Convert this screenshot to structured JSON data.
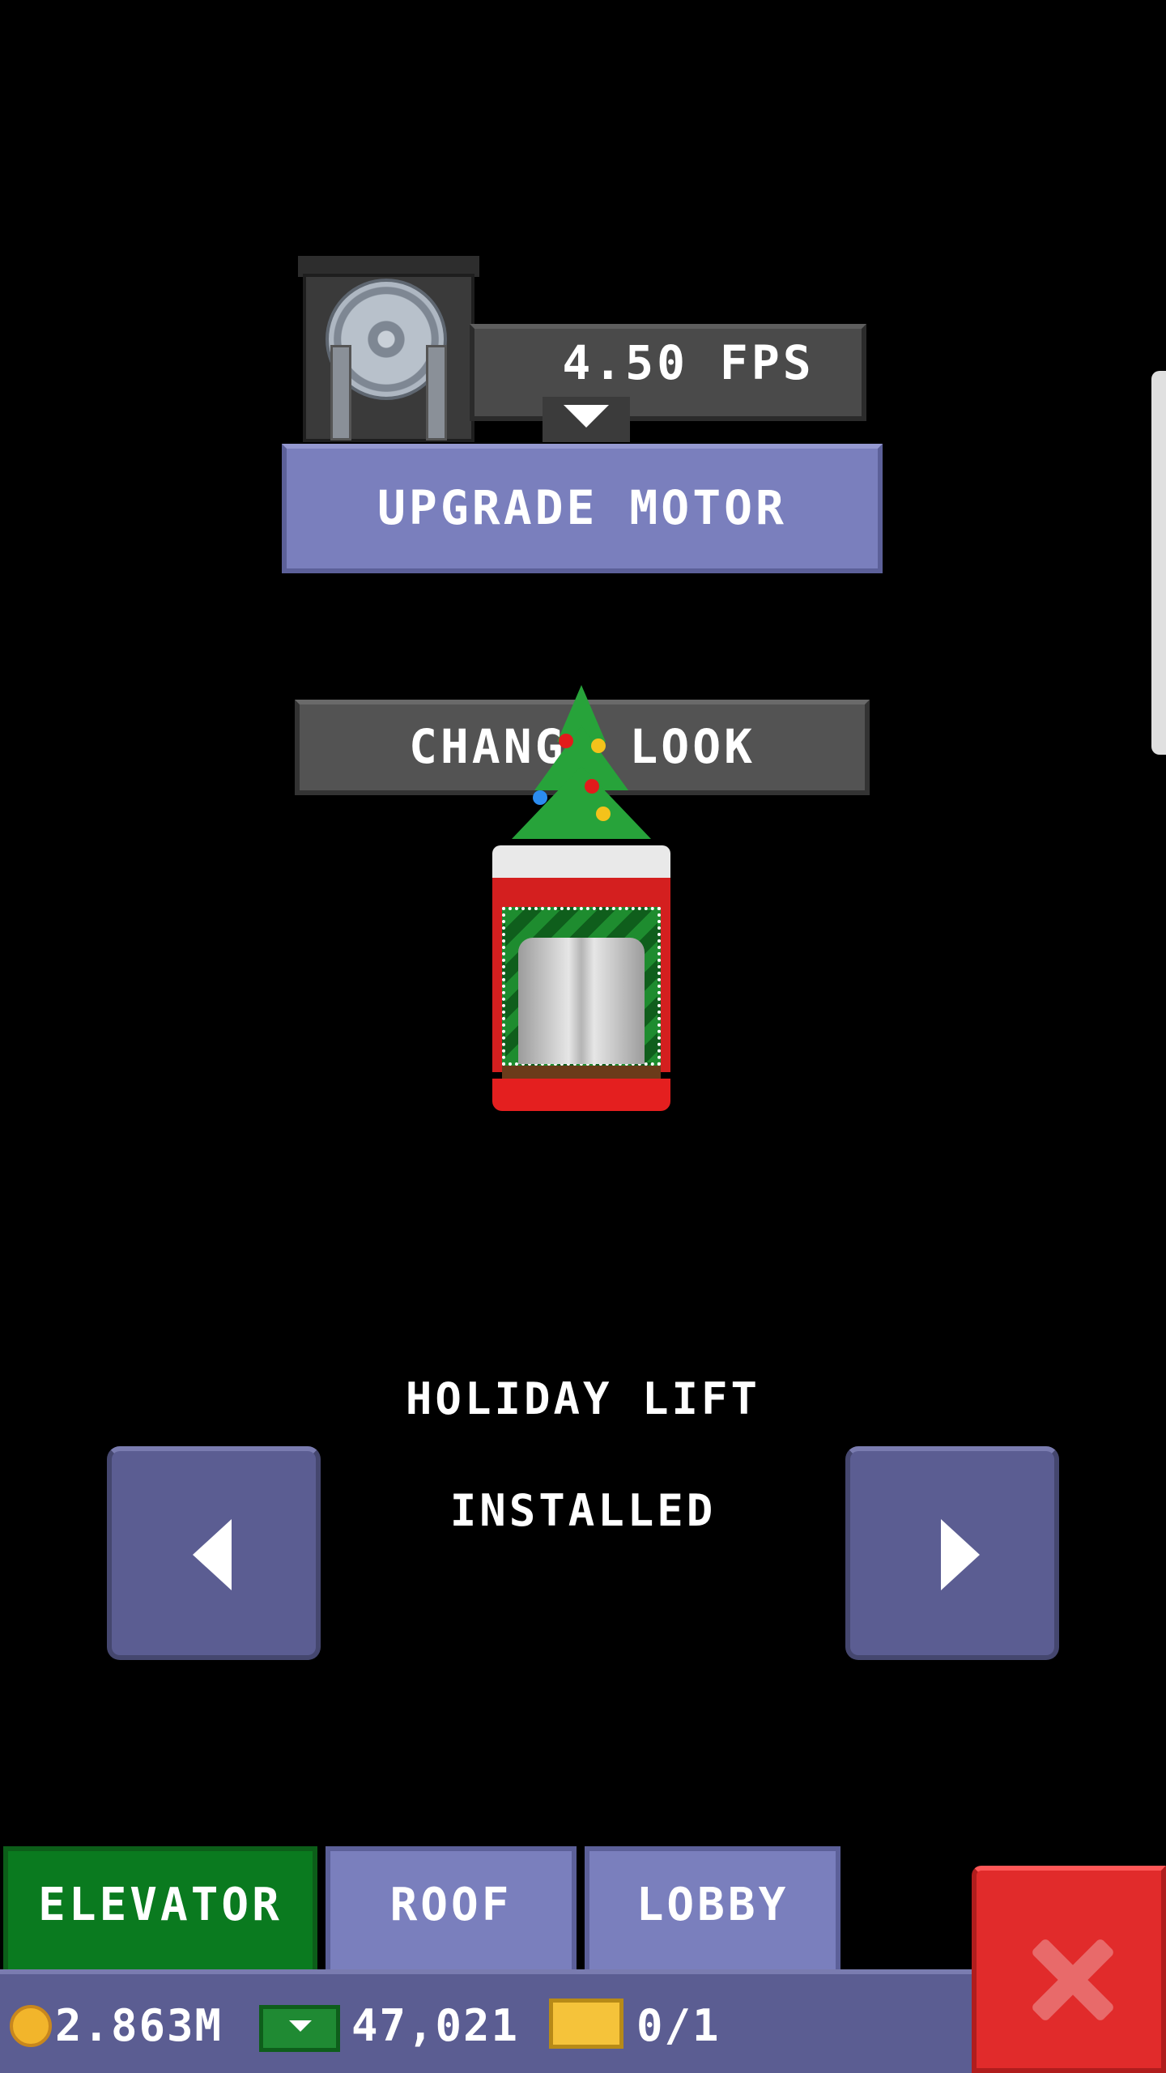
{
  "motor": {
    "fps_label": "4.50 FPS",
    "upgrade_label": "UPGRADE MOTOR"
  },
  "look": {
    "change_label": "CHANGE LOOK",
    "name": "HOLIDAY LIFT",
    "status": "INSTALLED"
  },
  "tabs": [
    {
      "label": "ELEVATOR",
      "active": true
    },
    {
      "label": "ROOF",
      "active": false
    },
    {
      "label": "LOBBY",
      "active": false
    }
  ],
  "status_bar": {
    "coins": "2.863M",
    "bux": "47,021",
    "tickets": "0/1"
  },
  "colors": {
    "button_purple": "#7a7fbd",
    "tab_active_green": "#0a7a1f",
    "close_red": "#e12b2b",
    "panel_gray": "#4a4a4a"
  },
  "icons": [
    "motor-icon",
    "coin-icon",
    "bux-icon",
    "ticket-icon",
    "close-icon",
    "left-arrow-icon",
    "right-arrow-icon",
    "dropdown-arrow-icon"
  ]
}
